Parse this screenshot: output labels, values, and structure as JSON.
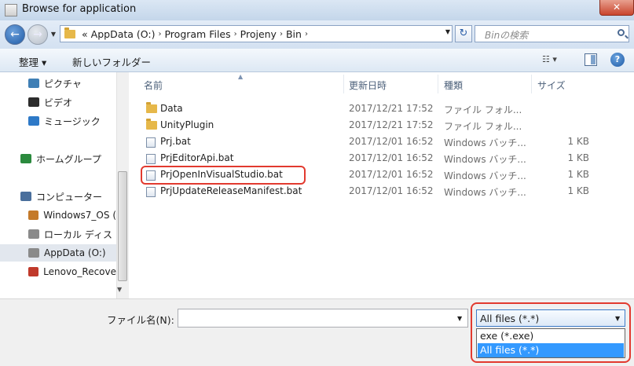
{
  "window": {
    "title": "Browse for application",
    "close_glyph": "✕"
  },
  "navigation": {
    "back_glyph": "←",
    "forward_glyph": "→",
    "breadcrumb": [
      "AppData (O:)",
      "Program Files",
      "Projeny",
      "Bin"
    ],
    "overflow_glyph": "«",
    "crumb_sep": "›",
    "search_placeholder": "Binの検索"
  },
  "toolbar": {
    "organize_label": "整理 ▾",
    "new_folder_label": "新しいフォルダー",
    "view_glyph": "☷ ▾",
    "help_glyph": "?"
  },
  "nav_pane": {
    "items": [
      {
        "label": "ピクチャ",
        "icon": "pictures-icon",
        "color": "#3f7fb5"
      },
      {
        "label": "ビデオ",
        "icon": "video-icon",
        "color": "#2c2c2c"
      },
      {
        "label": "ミュージック",
        "icon": "music-icon",
        "color": "#2e79c7"
      },
      {
        "label": "ホームグループ",
        "icon": "homegroup-icon",
        "color": "#2b8a3e"
      },
      {
        "label": "コンピューター",
        "icon": "computer-icon",
        "color": "#4a6f9c"
      },
      {
        "label": "Windows7_OS (",
        "icon": "drive-icon",
        "color": "#c47a2a"
      },
      {
        "label": "ローカル ディス",
        "icon": "drive-icon",
        "color": "#8a8a8a"
      },
      {
        "label": "AppData (O:)",
        "icon": "drive-icon",
        "color": "#8a8a8a",
        "selected": true
      },
      {
        "label": "Lenovo_Recove",
        "icon": "recovery-drive-icon",
        "color": "#c0392b"
      }
    ]
  },
  "file_list": {
    "columns": [
      "名前",
      "更新日時",
      "種類",
      "サイズ"
    ],
    "rows": [
      {
        "name": "Data",
        "date": "2017/12/21 17:52",
        "type": "ファイル フォル...",
        "size": "",
        "icon": "folder"
      },
      {
        "name": "UnityPlugin",
        "date": "2017/12/21 17:52",
        "type": "ファイル フォル...",
        "size": "",
        "icon": "folder"
      },
      {
        "name": "Prj.bat",
        "date": "2017/12/01 16:52",
        "type": "Windows バッチ...",
        "size": "1 KB",
        "icon": "bat"
      },
      {
        "name": "PrjEditorApi.bat",
        "date": "2017/12/01 16:52",
        "type": "Windows バッチ...",
        "size": "1 KB",
        "icon": "bat"
      },
      {
        "name": "PrjOpenInVisualStudio.bat",
        "date": "2017/12/01 16:52",
        "type": "Windows バッチ...",
        "size": "1 KB",
        "icon": "bat"
      },
      {
        "name": "PrjUpdateReleaseManifest.bat",
        "date": "2017/12/01 16:52",
        "type": "Windows バッチ...",
        "size": "1 KB",
        "icon": "bat"
      }
    ]
  },
  "bottom": {
    "filename_label": "ファイル名(N):",
    "filename_value": "",
    "filter_selected": "All files (*.*)",
    "filter_options": [
      "exe (*.exe)",
      "All files (*.*)"
    ]
  },
  "colors": {
    "highlight": "#e23a2f",
    "selection": "#3399ff"
  }
}
